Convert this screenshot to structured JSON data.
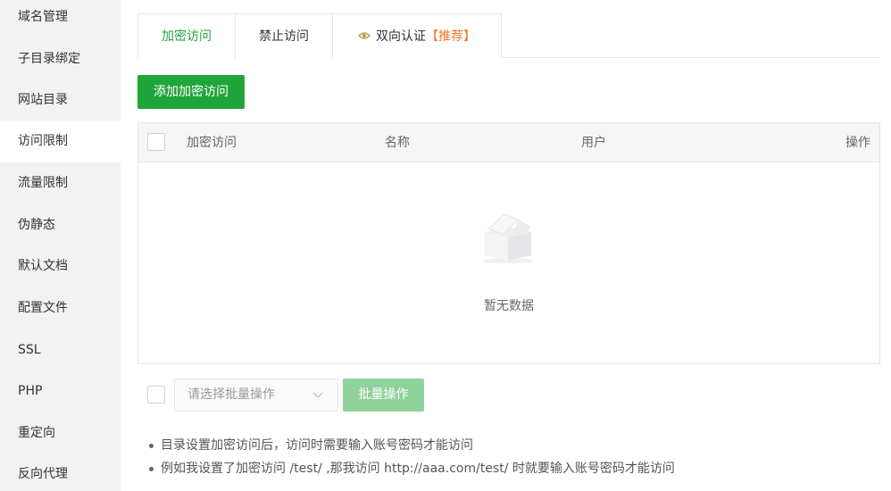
{
  "sidebar": {
    "items": [
      {
        "label": "域名管理"
      },
      {
        "label": "子目录绑定"
      },
      {
        "label": "网站目录"
      },
      {
        "label": "访问限制",
        "active": true
      },
      {
        "label": "流量限制"
      },
      {
        "label": "伪静态"
      },
      {
        "label": "默认文档"
      },
      {
        "label": "配置文件"
      },
      {
        "label": "SSL"
      },
      {
        "label": "PHP"
      },
      {
        "label": "重定向"
      },
      {
        "label": "反向代理"
      }
    ]
  },
  "tabs": {
    "encrypt": "加密访问",
    "forbid": "禁止访问",
    "two_way": "双向认证",
    "recommend": "【推荐】"
  },
  "toolbar": {
    "add_label": "添加加密访问"
  },
  "table": {
    "columns": [
      "加密访问",
      "名称",
      "用户",
      "操作"
    ],
    "rows": [],
    "empty_text": "暂无数据"
  },
  "batch": {
    "placeholder": "请选择批量操作",
    "button_label": "批量操作"
  },
  "tips": [
    "目录设置加密访问后，访问时需要输入账号密码才能访问",
    "例如我设置了加密访问 /test/ ,那我访问 http://aaa.com/test/ 时就要输入账号密码才能访问"
  ],
  "colors": {
    "accent": "#20a53a",
    "recommend": "#f0772b",
    "disabled_button": "#90d29c"
  }
}
